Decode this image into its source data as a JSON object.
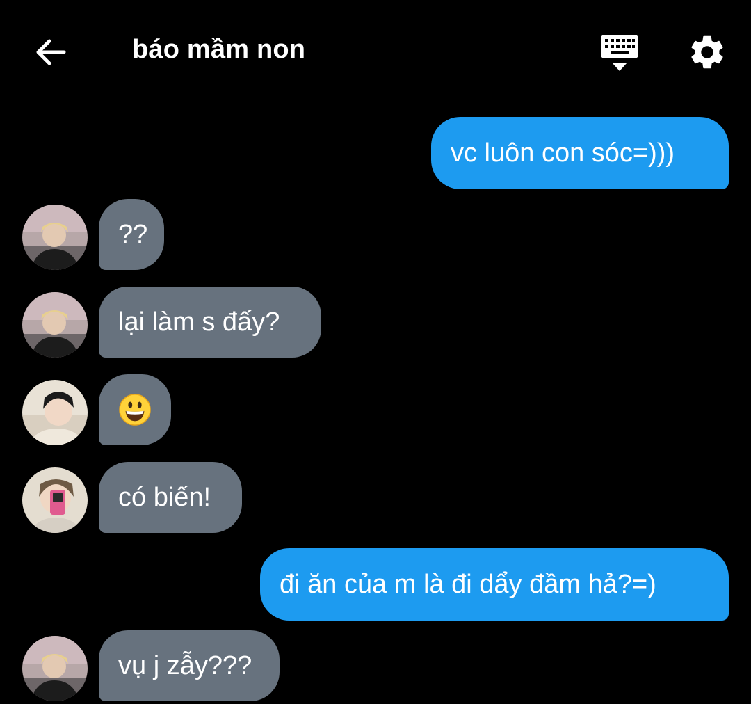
{
  "header": {
    "title": "báo mầm non"
  },
  "messages": [
    {
      "direction": "outgoing",
      "text": "vc luôn con sóc=)))"
    },
    {
      "direction": "incoming",
      "text": "??",
      "avatar": "avatar-blonde"
    },
    {
      "direction": "incoming",
      "text": "lại làm s đấy?",
      "avatar": "avatar-blonde"
    },
    {
      "direction": "incoming",
      "emoji": "grinning-face",
      "avatar": "avatar-dark-hair"
    },
    {
      "direction": "incoming",
      "text": "có biến!",
      "avatar": "avatar-mirror-selfie"
    },
    {
      "direction": "outgoing",
      "text": "đi ăn của m là đi dẩy đầm hả?=)"
    },
    {
      "direction": "incoming",
      "text": "vụ j zẫy???",
      "avatar": "avatar-blonde"
    }
  ],
  "colors": {
    "background": "#000000",
    "outgoing_bubble": "#1d9bf0",
    "incoming_bubble": "#67727e",
    "text": "#ffffff"
  }
}
